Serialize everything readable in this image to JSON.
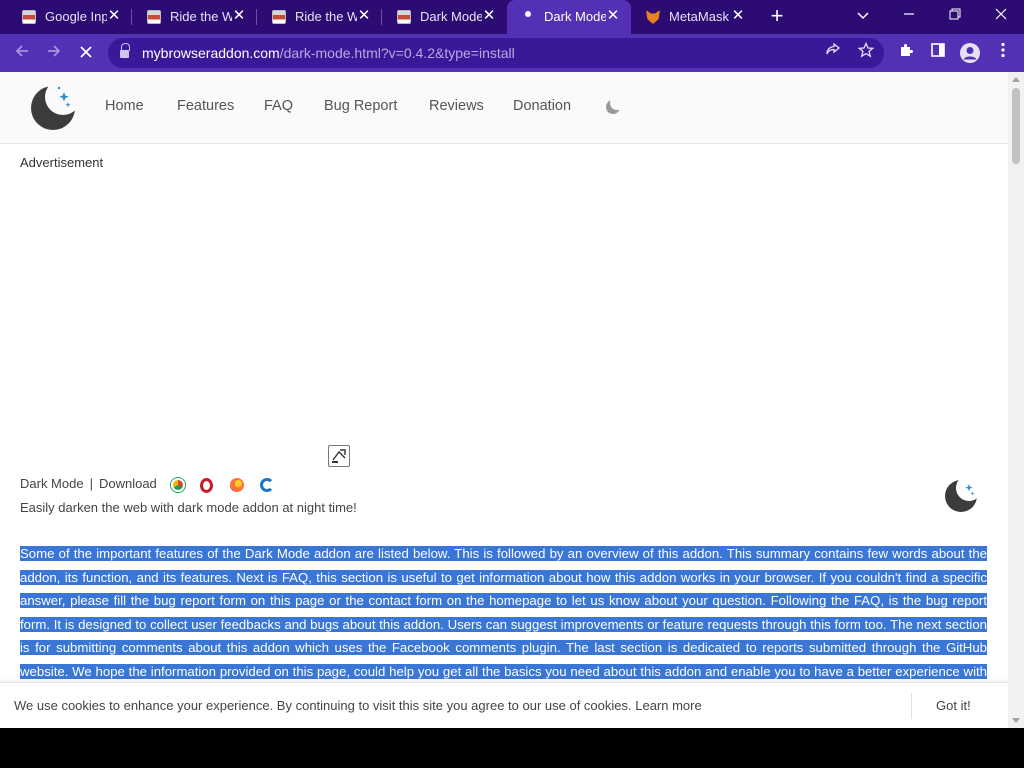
{
  "browser": {
    "tabs": [
      {
        "title": "Google Inp",
        "favicon": "image-favicon",
        "active": false
      },
      {
        "title": "Ride the W",
        "favicon": "image-favicon",
        "active": false
      },
      {
        "title": "Ride the W",
        "favicon": "image-favicon",
        "active": false
      },
      {
        "title": "Dark Mode",
        "favicon": "image-favicon",
        "active": false
      },
      {
        "title": "Dark Mode",
        "favicon": "moon-favicon",
        "active": true
      },
      {
        "title": "MetaMask",
        "favicon": "fox-favicon",
        "active": false
      }
    ],
    "close_glyph": "✕",
    "new_tab_glyph": "+",
    "url_domain": "mybrowseraddon.com",
    "url_path": "/dark-mode.html?v=0.4.2&type=install",
    "colors": {
      "frame": "#2c0b72",
      "toolbar": "#5330b4",
      "omnibox": "#3b1897",
      "selection": "#3a76d6"
    }
  },
  "site": {
    "nav": [
      "Home",
      "Features",
      "FAQ",
      "Bug Report",
      "Reviews",
      "Donation"
    ],
    "ad_label": "Advertisement",
    "brand": "Dark Mode",
    "separator": "|",
    "download": "Download",
    "tagline": "Easily darken the web with dark mode addon at night time!",
    "summary": "Some of the important features of the Dark Mode addon are listed below. This is followed by an overview of this addon. This summary contains few words about the addon, its function, and its features. Next is FAQ, this section is useful to get information about how this addon works in your browser. If you couldn't find a specific answer, please fill the bug report form on this page or the contact form on the homepage to let us know about your question. Following the FAQ, is the bug report form. It is designed to collect user feedbacks and bugs about this addon. Users can suggest improvements or feature requests through this form too. The next section is for submitting comments about this addon which uses the Facebook comments plugin. The last section is dedicated to reports submitted through the GitHub website. We hope the information provided on this page, could help you get all the basics you need about this addon and enable you to have a better experience with Dark Mode."
  },
  "cookie": {
    "text": "We use cookies to enhance your experience. By continuing to visit this site you agree to our use of cookies.",
    "learn_more": "Learn more",
    "button": "Got it!"
  }
}
